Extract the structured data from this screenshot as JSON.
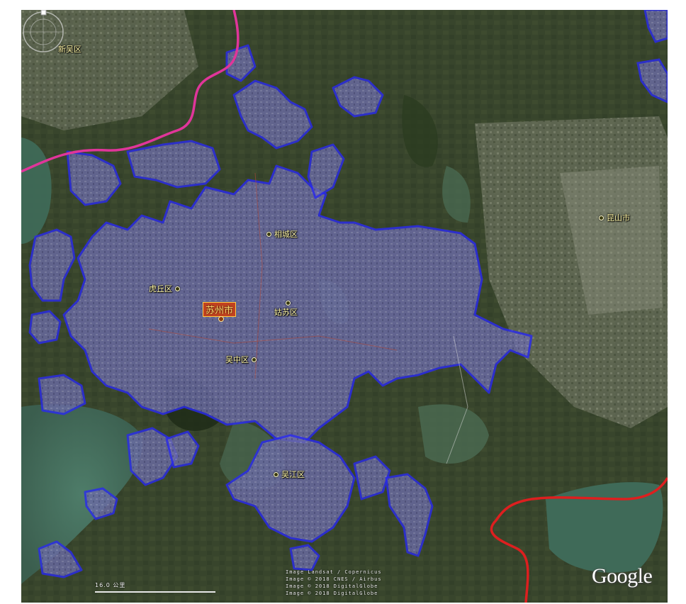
{
  "map": {
    "labels": {
      "xinwu": "新吴区",
      "xiangcheng": "相城区",
      "huqiu": "虎丘区",
      "suzhou": "苏州市",
      "gusu": "姑苏区",
      "wuzhong": "吴中区",
      "wujiang": "吴江区",
      "kunshan": "昆山市"
    },
    "scale_label": "16.0 公里",
    "credits": [
      "Image Landsat / Copernicus",
      "Image © 2018 CNES / Airbus",
      "Image © 2018 DigitalGlobe",
      "Image © 2018 DigitalGlobe"
    ],
    "logo": "Google",
    "colors": {
      "urban_boundary": "#2a2af0",
      "urban_fill": "#6a6aa8",
      "province_border": "#e0359a",
      "city_border": "#dd1f1f"
    }
  }
}
